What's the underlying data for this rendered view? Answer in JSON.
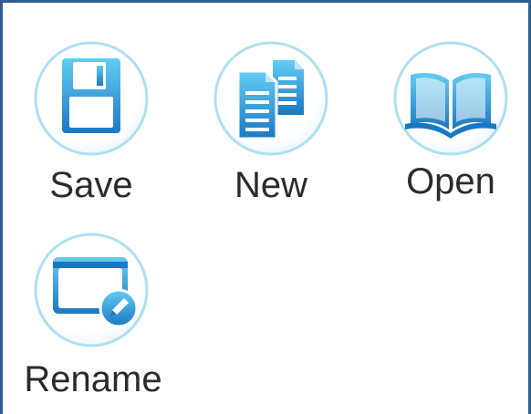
{
  "icons": [
    {
      "id": "save",
      "label": "Save",
      "icon": "floppy-disk-icon"
    },
    {
      "id": "new",
      "label": "New",
      "icon": "documents-icon"
    },
    {
      "id": "open",
      "label": "Open",
      "icon": "open-book-icon"
    },
    {
      "id": "rename",
      "label": "Rename",
      "icon": "card-pencil-icon"
    }
  ],
  "colors": {
    "frame": "#2f5f8f",
    "icon_light": "#5cc8f2",
    "icon_dark": "#1f7fc6",
    "badge_ring": "#b8e4f4",
    "label_text": "#2b2b2b"
  }
}
